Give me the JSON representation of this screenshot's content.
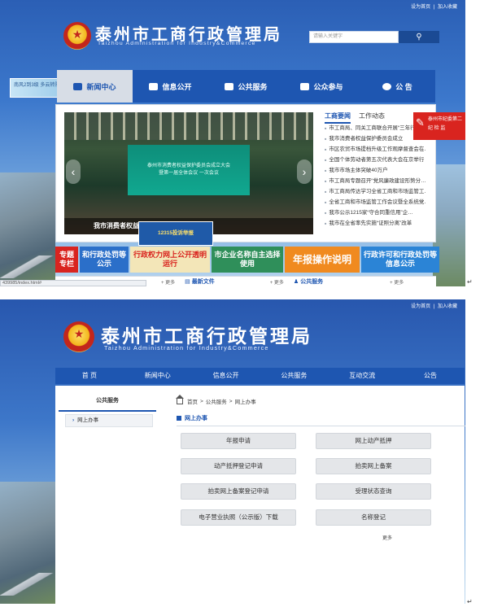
{
  "top_links": {
    "home": "设为首页",
    "sep": "|",
    "fav": "加入收藏"
  },
  "logo": {
    "cn": "泰州市工商行政管理局",
    "en": "Taizhou Administration for Industry&Commerce"
  },
  "search": {
    "placeholder": "请输入关键字"
  },
  "weather": {
    "text": "南风2到3级 多云转阴"
  },
  "nav1": {
    "items": [
      "新闻中心",
      "信息公开",
      "公共服务",
      "公众参与",
      "公 告"
    ],
    "active_index": 0
  },
  "news": {
    "tabs": [
      "工商要闻",
      "工作动态"
    ],
    "items": [
      "市工商局、同关工商联合开展“三年行动”",
      "我市消费者权益保护委员会成立",
      "市区农贸市场提档升级工作观摩督查会在…",
      "全国个体劳动者第五次代表大会在京举行",
      "我市市场主体突破40万户",
      "市工商局专题召开“党风廉政建设形势分…",
      "市工商局传达学习全省工商和市场监管工…",
      "全省工商和市场监管工作会议暨全系统党…",
      "我市公示1215家“守合同重信用”企…",
      "我市在全省率先实施“证照分离”改革"
    ]
  },
  "slide": {
    "caption": "我市消费者权益保护委员会成立",
    "screen_line1": "泰州市消费者权益保护委员会成立大会",
    "screen_line2": "暨第一届全体会议 一次会议"
  },
  "red_tag": {
    "line1": "泰州市纪委第二",
    "line2": "纪 检 监"
  },
  "hotline": {
    "text": "12315投诉举报"
  },
  "banners": [
    {
      "text": "专题专栏",
      "color": "#d9241f"
    },
    {
      "text": "和行政处罚等公示",
      "color": "#2b6fc9"
    },
    {
      "text": "行政权力网上公开透明运行",
      "color": "#f3e6b8"
    },
    {
      "text": "市企业名称自主选择使用",
      "color": "#2f8f5a"
    },
    {
      "text": "年报操作说明",
      "color": "#f08a1f"
    },
    {
      "text": "行政许可和行政处罚等信息公示",
      "color": "#2b84d6"
    }
  ],
  "bottom1": {
    "more": "+ 更多",
    "latest_files": "最新文件",
    "more2": "+ 更多",
    "public_service": "公共服务",
    "more3": "+ 更多"
  },
  "status_url": {
    "text": "439985/index.html#"
  },
  "nav2": {
    "items": [
      "首 页",
      "新闻中心",
      "信息公开",
      "公共服务",
      "互动交流",
      "公告"
    ]
  },
  "sidebar": {
    "title": "公共服务",
    "items": [
      "网上办事"
    ]
  },
  "breadcrumb": {
    "home": "首页",
    "sep1": ">",
    "level1": "公共服务",
    "sep2": ">",
    "level2": "网上办事"
  },
  "section": {
    "title": "网上办事"
  },
  "services": [
    "年报申请",
    "网上动产抵押",
    "动产抵押登记申请",
    "拍卖网上备案",
    "拍卖网上备案登记申请",
    "受理状态查询",
    "电子营业执照（公示版）下载",
    "名称登记"
  ],
  "more_label": "更多",
  "return_mark": "↵"
}
